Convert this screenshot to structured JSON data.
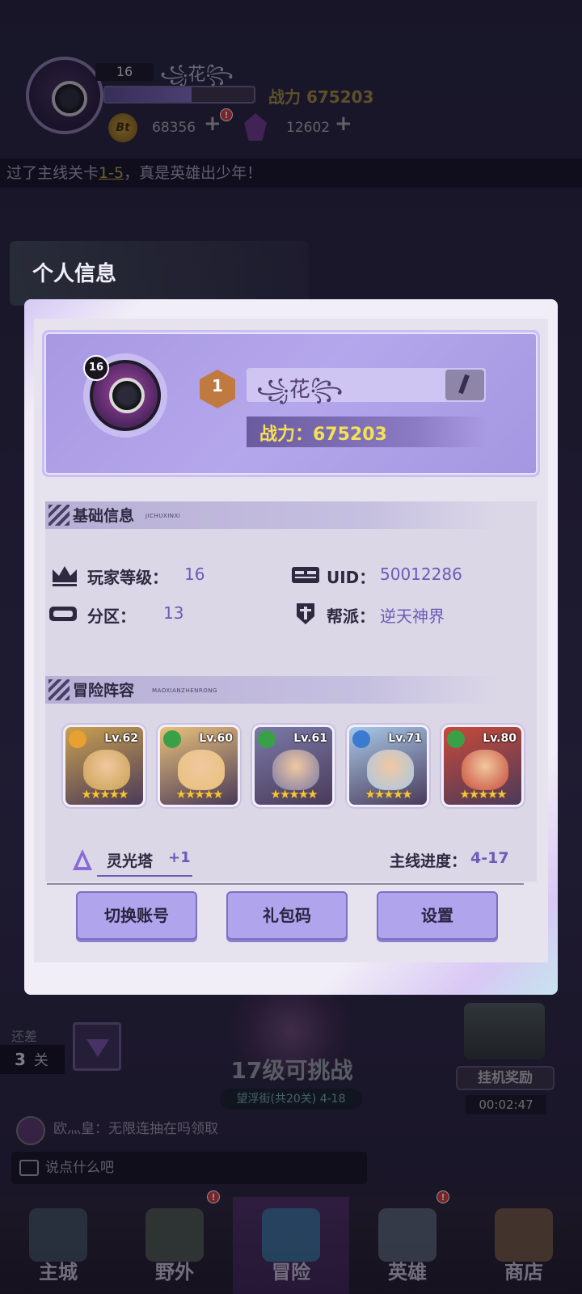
{
  "hud": {
    "level": "16",
    "name": "꧁花꧂",
    "power": "战力 675203",
    "exp_fraction": 0.58,
    "coin_symbol": "Bt",
    "coins": "68356",
    "gems": "12602",
    "plus": "+",
    "alert": "!",
    "ticker_pre": "过了主线关卡",
    "ticker_stage": "1-5",
    "ticker_post": "，真是英雄出少年！"
  },
  "panel_title": "个人信息",
  "profile": {
    "level": "16",
    "rank": "1",
    "name": "꧁花꧂",
    "power": "战力：675203"
  },
  "basic": {
    "title": "基础信息",
    "subtitle": "JICHUXINXI",
    "player_level_label": "玩家等级：",
    "player_level": "16",
    "uid_label": "UID：",
    "uid": "50012286",
    "zone_label": "分区：",
    "zone": "13",
    "guild_label": "帮派：",
    "guild": "逆天神界"
  },
  "lineup": {
    "title": "冒险阵容",
    "subtitle": "MAOXIANZHENRONG",
    "heroes": [
      {
        "level": "Lv.62",
        "stars": "★★★★★",
        "class_color": "#e8a030",
        "bg": "#c9a050"
      },
      {
        "level": "Lv.60",
        "stars": "★★★★★",
        "class_color": "#3aa048",
        "bg": "#e8c07a"
      },
      {
        "level": "Lv.61",
        "stars": "★★★★★",
        "class_color": "#3aa048",
        "bg": "#7a7aa8"
      },
      {
        "level": "Lv.71",
        "stars": "★★★★★",
        "class_color": "#3a7ad0",
        "bg": "#a8c8e8"
      },
      {
        "level": "Lv.80",
        "stars": "★★★★★",
        "class_color": "#3aa048",
        "bg": "#c84a3a"
      }
    ],
    "tower_label": "灵光塔",
    "tower_value": "+1",
    "progress_label": "主线进度：",
    "progress_value": "4-17"
  },
  "buttons": {
    "switch_account": "切换账号",
    "gift_code": "礼包码",
    "settings": "设置"
  },
  "background": {
    "remain_label": "还差",
    "remain_count": "3",
    "remain_unit": "关",
    "challenge_text": "17级可挑战",
    "stage_tag": "望浮街(共20关) 4-18",
    "afk_label": "挂机奖励",
    "afk_time": "00:02:47",
    "chat_line": "欧灬皇：无限连抽在吗领取",
    "chat_placeholder": "说点什么吧"
  },
  "nav": [
    {
      "label": "主城",
      "color": "#4a6070"
    },
    {
      "label": "野外",
      "color": "#5a6a5a"
    },
    {
      "label": "冒险",
      "color": "#3a8ab0"
    },
    {
      "label": "英雄",
      "color": "#6a7a8a"
    },
    {
      "label": "商店",
      "color": "#8a6a4a"
    }
  ],
  "colors": {
    "accent": "#6a5cb8",
    "button": "#b0a4ec",
    "power_gold": "#f5e154"
  }
}
